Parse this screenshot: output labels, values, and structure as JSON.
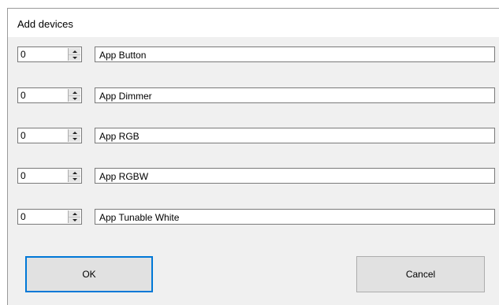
{
  "dialog": {
    "title": "Add devices"
  },
  "devices": [
    {
      "count": "0",
      "name": "App Button"
    },
    {
      "count": "0",
      "name": "App Dimmer"
    },
    {
      "count": "0",
      "name": "App RGB"
    },
    {
      "count": "0",
      "name": "App RGBW"
    },
    {
      "count": "0",
      "name": "App Tunable White"
    }
  ],
  "buttons": {
    "ok": "OK",
    "cancel": "Cancel"
  },
  "icons": {
    "spin_up": "chevron-up-icon",
    "spin_down": "chevron-down-icon"
  },
  "colors": {
    "dialog_bg": "#f0f0f0",
    "default_button_border": "#0078d7",
    "button_bg": "#e1e1e1"
  }
}
